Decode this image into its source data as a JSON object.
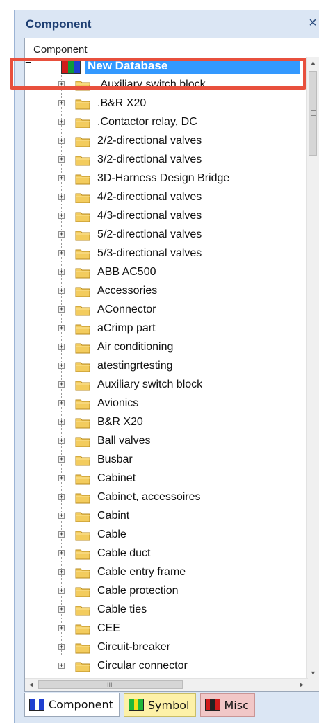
{
  "panel": {
    "title": "Component",
    "close_glyph": "×"
  },
  "tree": {
    "column_header": "Component",
    "root": {
      "label": "New Database",
      "expander": "−",
      "colors": [
        "#d11b1b",
        "#0e9a3a",
        "#1f3fd0"
      ]
    },
    "items": [
      ".Auxiliary switch block",
      ".B&R X20",
      ".Contactor relay, DC",
      "2/2-directional valves",
      "3/2-directional valves",
      "3D-Harness Design Bridge",
      "4/2-directional valves",
      "4/3-directional valves",
      "5/2-directional valves",
      "5/3-directional valves",
      "ABB AC500",
      "Accessories",
      "AConnector",
      "aCrimp part",
      "Air conditioning",
      "atestingrtesting",
      "Auxiliary switch block",
      "Avionics",
      "B&R X20",
      "Ball valves",
      "Busbar",
      "Cabinet",
      "Cabinet, accessoires",
      "Cabint",
      "Cable",
      "Cable duct",
      "Cable entry frame",
      "Cable protection",
      "Cable ties",
      "CEE",
      "Circuit-breaker",
      "Circular connector"
    ],
    "item_expander": "+"
  },
  "scrollbars": {
    "up": "▲",
    "down": "▼",
    "left": "◄",
    "right": "►",
    "h_grip": "III"
  },
  "tabs": [
    {
      "label": "Component",
      "icon": "component-db-icon",
      "colors": [
        "#1f3fd0",
        "#ffffff",
        "#1f3fd0"
      ]
    },
    {
      "label": "Symbol",
      "icon": "symbol-db-icon",
      "colors": [
        "#1fb83a",
        "#f4e01a",
        "#1fb83a"
      ]
    },
    {
      "label": "Misc",
      "icon": "misc-db-icon",
      "colors": [
        "#d11b1b",
        "#222222",
        "#d11b1b"
      ]
    }
  ],
  "colors": {
    "selection": "#3399ff",
    "highlight_box": "#e8503d",
    "title": "#1e3f73"
  }
}
